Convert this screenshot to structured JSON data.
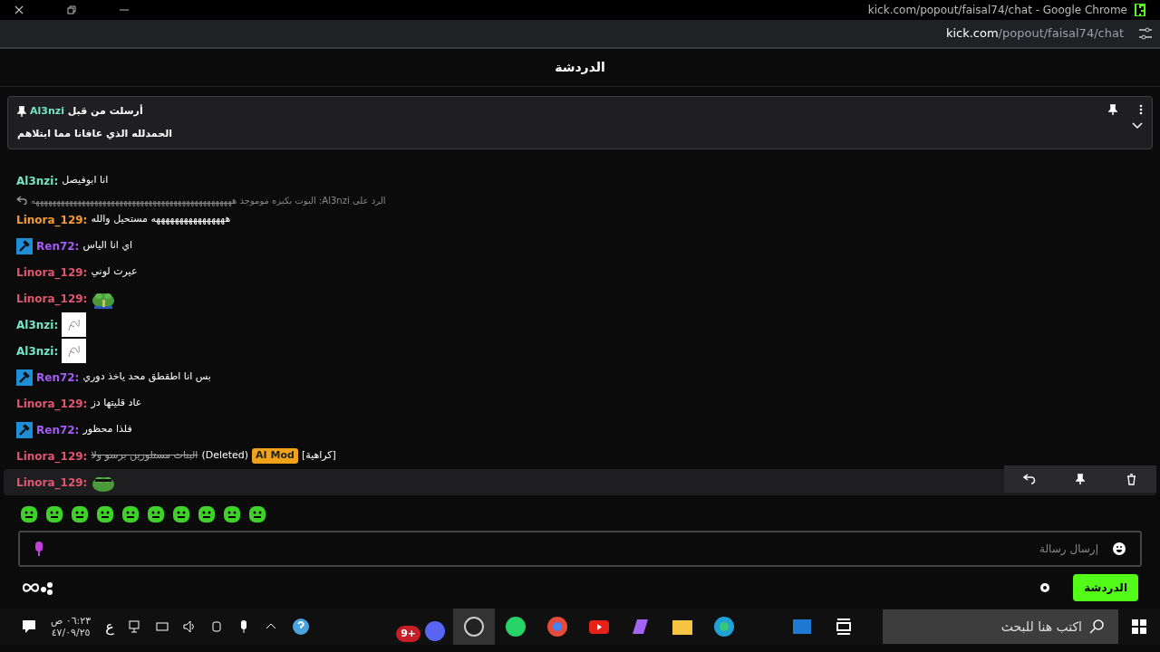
{
  "window": {
    "title": "kick.com/popout/faisal74/chat - Google Chrome"
  },
  "address_bar": {
    "host": "kick.com",
    "path": "/popout/faisal74/chat"
  },
  "chat_header": {
    "title": "الدردشة"
  },
  "pinned": {
    "sender": "Al3nzi",
    "label": "أرسلت من قبل",
    "text": "الحمدلله الذي عافانا مما ابتلاهم"
  },
  "messages": [
    {
      "kind": "text",
      "user": "Al3nzi:",
      "color": "#75e6c8",
      "moderator": false,
      "hovered": false,
      "text": "انا ابوفيصل"
    },
    {
      "kind": "text",
      "user": "Linora_129:",
      "color": "#f39c32",
      "moderator": false,
      "hovered": false,
      "reply": "الرد على Al3nzi: البوت بكيزه موموجد ههههههههههههههههههههههههههههههههههههههههههههههههه",
      "text": "ههههههههههههههههه مستحيل والله"
    },
    {
      "kind": "text",
      "user": "Ren72:",
      "color": "#a45cf5",
      "moderator": true,
      "hovered": false,
      "text": "اي انا الياس"
    },
    {
      "kind": "text",
      "user": "Linora_129:",
      "color": "#e0566f",
      "moderator": false,
      "hovered": false,
      "text": "عيرت لوني"
    },
    {
      "kind": "emote",
      "user": "Linora_129:",
      "color": "#e0566f",
      "moderator": false,
      "hovered": false
    },
    {
      "kind": "image",
      "user": "Al3nzi:",
      "color": "#75e6c8",
      "moderator": false,
      "hovered": false
    },
    {
      "kind": "image",
      "user": "Al3nzi:",
      "color": "#75e6c8",
      "moderator": false,
      "hovered": false
    },
    {
      "kind": "text",
      "user": "Ren72:",
      "color": "#a45cf5",
      "moderator": true,
      "hovered": false,
      "text": "بس انا اطقطق محد ياخذ دوري"
    },
    {
      "kind": "text",
      "user": "Linora_129:",
      "color": "#e0566f",
      "moderator": false,
      "hovered": false,
      "text": "عاد قليتها دز"
    },
    {
      "kind": "text",
      "user": "Ren72:",
      "color": "#a45cf5",
      "moderator": true,
      "hovered": false,
      "text": "فلذا محظور"
    },
    {
      "kind": "deleted",
      "user": "Linora_129:",
      "color": "#e0566f",
      "moderator": false,
      "hovered": false,
      "text": "البنات مستلورين برسو ولا",
      "deleted_label": "(Deleted)",
      "mod_badge": "AI Mod",
      "reason": "[كراهية]"
    },
    {
      "kind": "emote",
      "user": "Linora_129:",
      "color": "#e0566f",
      "moderator": false,
      "hovered": true
    }
  ],
  "message_input": {
    "placeholder": "إرسال رسالة"
  },
  "chat_button": "الدردشة",
  "taskbar": {
    "search_placeholder": "اكتب هنا للبحث",
    "time": "٠٦:٢٣ ص",
    "date": "٤٧/٠٩/٢٥",
    "language": "ع",
    "discord_badge": "9+"
  }
}
